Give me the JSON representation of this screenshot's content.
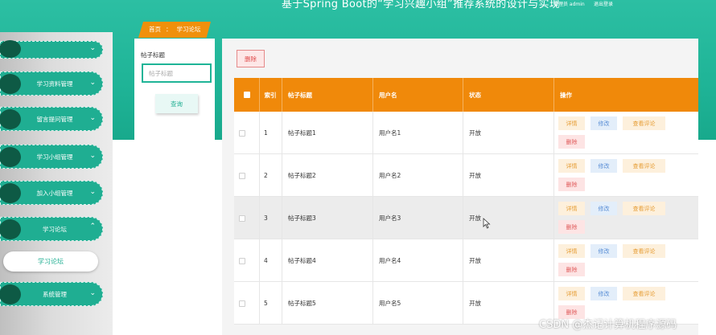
{
  "header": {
    "title": "基于Spring Boot的“学习兴趣小组”推荐系统的设计与实现",
    "user": "管理员 admin",
    "logout": "退出登录"
  },
  "sidebar": {
    "items": [
      {
        "label": ""
      },
      {
        "label": "学习资料管理"
      },
      {
        "label": "留言提问管理"
      },
      {
        "label": "学习小组管理"
      },
      {
        "label": "加入小组管理"
      },
      {
        "label": "学习论坛",
        "expanded": true
      },
      {
        "label": "系统管理"
      }
    ],
    "sub_item": "学习论坛"
  },
  "breadcrumb": {
    "home": "首页",
    "sep": "：",
    "current": "学习论坛"
  },
  "search": {
    "label": "帖子标题",
    "placeholder": "帖子标题",
    "button": "查询"
  },
  "toolbar": {
    "delete_label": "删除"
  },
  "table": {
    "headers": {
      "index": "索引",
      "title": "帖子标题",
      "username": "用户名",
      "status": "状态",
      "actions": "操作"
    },
    "rows": [
      {
        "index": "1",
        "title": "帖子标题1",
        "username": "用户名1",
        "status": "开放"
      },
      {
        "index": "2",
        "title": "帖子标题2",
        "username": "用户名2",
        "status": "开放"
      },
      {
        "index": "3",
        "title": "帖子标题3",
        "username": "用户名3",
        "status": "开放"
      },
      {
        "index": "4",
        "title": "帖子标题4",
        "username": "用户名4",
        "status": "开放"
      },
      {
        "index": "5",
        "title": "帖子标题5",
        "username": "用户名5",
        "status": "开放"
      }
    ],
    "action_labels": {
      "detail": "详情",
      "edit": "修改",
      "comments": "查看评论",
      "delete": "删除"
    }
  },
  "watermark": "CSDN @杰记计算机程序源码",
  "colors": {
    "theme_teal": "#1fb497",
    "header_orange": "#f0890a",
    "delete_red": "#e04b4b"
  }
}
